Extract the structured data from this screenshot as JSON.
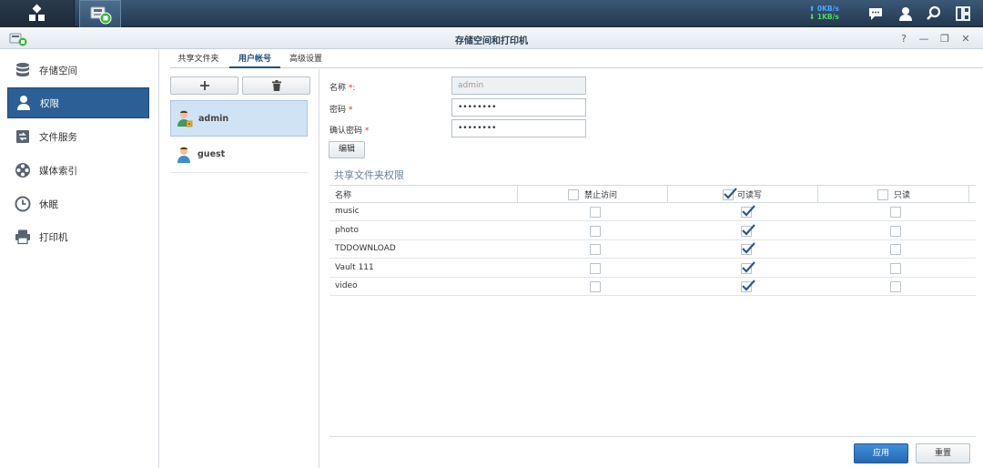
{
  "taskbar": {
    "main_menu_icon": "main-menu-icon",
    "active_app_icon": "storage-printer-app-icon",
    "net_up": "0KB/s",
    "net_down": "1KB/s",
    "icons": [
      "chat-icon",
      "user-icon",
      "search-icon",
      "widgets-icon"
    ]
  },
  "window": {
    "title": "存储空间和打印机",
    "controls": [
      "?",
      "—",
      "❐",
      "✕"
    ]
  },
  "sidebar": {
    "items": [
      {
        "label": "存储空间",
        "icon": "database-icon"
      },
      {
        "label": "权限",
        "icon": "user-icon",
        "active": true
      },
      {
        "label": "文件服务",
        "icon": "file-service-icon"
      },
      {
        "label": "媒体索引",
        "icon": "film-reel-icon"
      },
      {
        "label": "休眠",
        "icon": "clock-icon"
      },
      {
        "label": "打印机",
        "icon": "printer-icon"
      }
    ]
  },
  "tabs": [
    {
      "label": "共享文件夹"
    },
    {
      "label": "用户帐号",
      "active": true
    },
    {
      "label": "高级设置"
    }
  ],
  "users": [
    {
      "name": "admin",
      "selected": true
    },
    {
      "name": "guest"
    }
  ],
  "form": {
    "name_label": "名称",
    "name_req": "*:",
    "name_value": "admin",
    "password_label": "密码",
    "password_req": "*",
    "password_value": "••••••••",
    "confirm_label": "确认密码",
    "confirm_req": "*",
    "confirm_value": "••••••••",
    "edit_label": "编辑"
  },
  "permissions": {
    "section_title": "共享文件夹权限",
    "headers": {
      "name": "名称",
      "deny": "禁止访问",
      "rw": "可读写",
      "ro": "只读"
    },
    "header_checked": {
      "deny": false,
      "rw": true,
      "ro": false
    },
    "rows": [
      {
        "name": "music",
        "deny": false,
        "rw": true,
        "ro": false
      },
      {
        "name": "photo",
        "deny": false,
        "rw": true,
        "ro": false
      },
      {
        "name": "TDDOWNLOAD",
        "deny": false,
        "rw": true,
        "ro": false
      },
      {
        "name": "Vault 111",
        "deny": false,
        "rw": true,
        "ro": false
      },
      {
        "name": "video",
        "deny": false,
        "rw": true,
        "ro": false
      }
    ]
  },
  "footer": {
    "apply_label": "应用",
    "reset_label": "重置"
  }
}
